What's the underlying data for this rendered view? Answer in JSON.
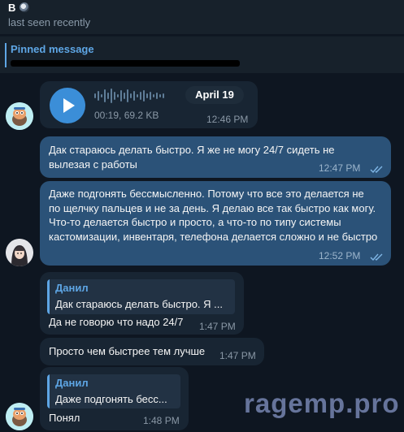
{
  "header": {
    "name": "B",
    "status": "last seen recently"
  },
  "pinned": {
    "title": "Pinned message"
  },
  "voice_message": {
    "duration_size": "00:19, 69.2 KB",
    "time": "12:46 PM"
  },
  "date_pill": "April 19",
  "messages": [
    {
      "text": "Дак стараюсь делать быстро. Я же не могу 24/7 сидеть не вылезая с работы",
      "time": "12:47 PM"
    },
    {
      "text": "Даже подгонять бессмысленно. Потому что все это делается не по щелчку пальцев и не за день. Я делаю все так быстро как могу. Что-то делается быстро и просто, а что-то по типу системы кастомизации, инвентаря, телефона делается сложно и не быстро",
      "time": "12:52 PM"
    },
    {
      "reply_name": "Данил",
      "reply_text": "Дак стараюсь делать быстро. Я ...",
      "text": "Да не говорю что надо 24/7",
      "time": "1:47 PM"
    },
    {
      "text": "Просто чем быстрее тем лучше",
      "time": "1:47 PM"
    },
    {
      "reply_name": "Данил",
      "reply_text": "Даже подгонять бесс...",
      "text": "Понял",
      "time": "1:48 PM"
    }
  ],
  "watermark": "ragemp.pro",
  "colors": {
    "background": "#0e1621",
    "header": "#17212b",
    "incoming_bubble": "#182533",
    "outgoing_bubble": "#2b5278",
    "accent": "#5ea6e5"
  }
}
